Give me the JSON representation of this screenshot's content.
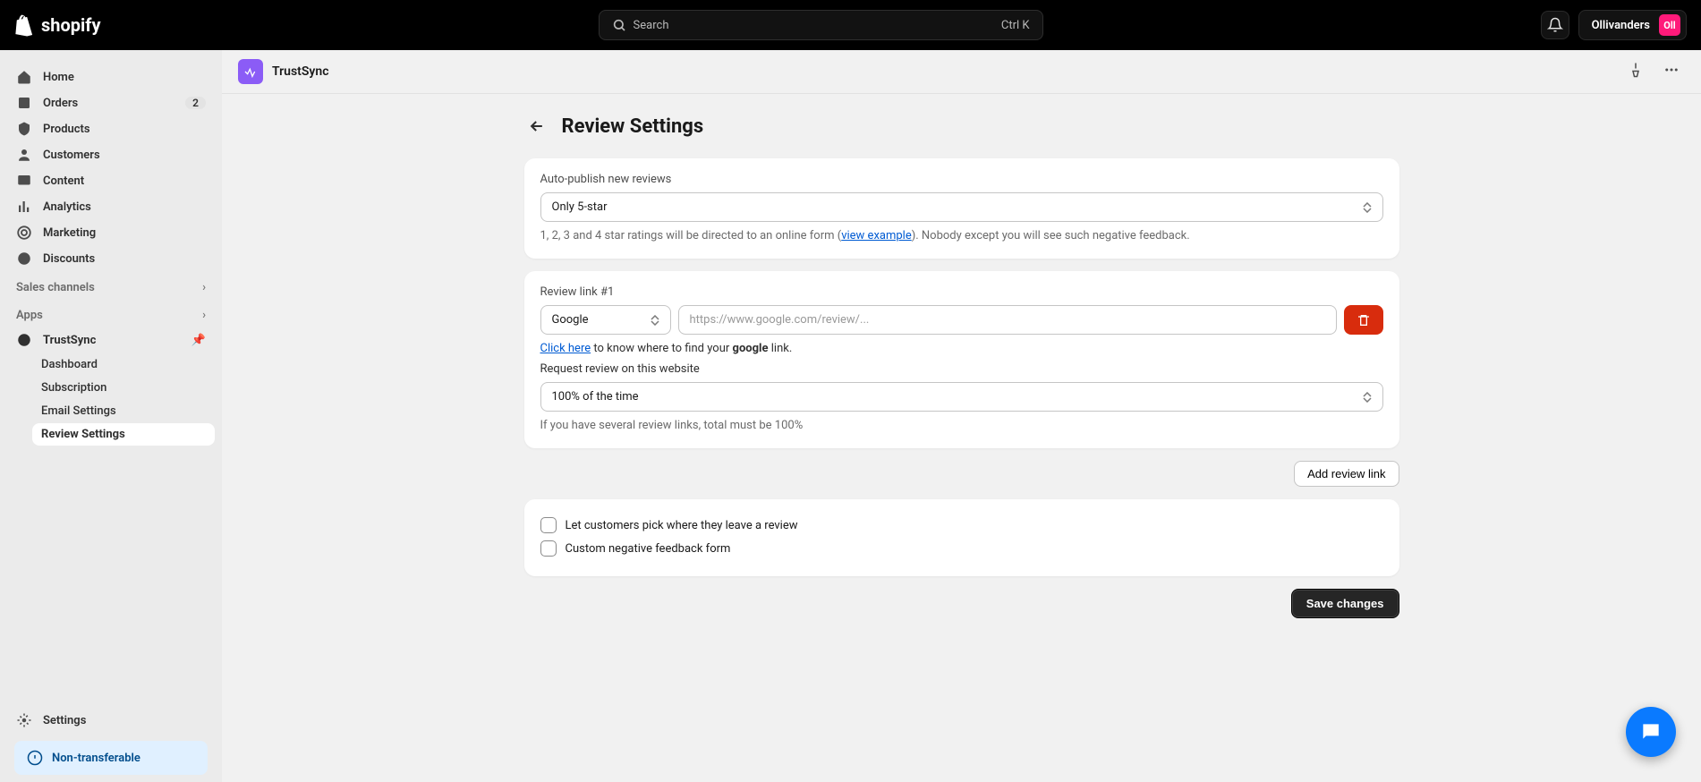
{
  "topbar": {
    "logo_text": "shopify",
    "search_placeholder": "Search",
    "search_shortcut": "Ctrl K",
    "store_name": "Ollivanders",
    "store_initials": "Oll"
  },
  "sidebar": {
    "items": [
      {
        "label": "Home",
        "icon": "home"
      },
      {
        "label": "Orders",
        "icon": "orders",
        "badge": "2"
      },
      {
        "label": "Products",
        "icon": "products"
      },
      {
        "label": "Customers",
        "icon": "customers"
      },
      {
        "label": "Content",
        "icon": "content"
      },
      {
        "label": "Analytics",
        "icon": "analytics"
      },
      {
        "label": "Marketing",
        "icon": "marketing"
      },
      {
        "label": "Discounts",
        "icon": "discounts"
      }
    ],
    "sales_channels_label": "Sales channels",
    "apps_label": "Apps",
    "app_name": "TrustSync",
    "app_subitems": [
      "Dashboard",
      "Subscription",
      "Email Settings",
      "Review Settings"
    ],
    "app_active_index": 3,
    "settings_label": "Settings",
    "pill_label": "Non-transferable"
  },
  "header": {
    "app_title": "TrustSync"
  },
  "page": {
    "title": "Review Settings",
    "card1": {
      "label": "Auto-publish new reviews",
      "select_value": "Only 5-star",
      "help_pre": "1, 2, 3 and 4 star ratings will be directed to an online form (",
      "help_link": "view example",
      "help_post": "). Nobody except you will see such negative feedback."
    },
    "card2": {
      "label": "Review link #1",
      "platform_value": "Google",
      "url_placeholder": "https://www.google.com/review/...",
      "hint_link": "Click here",
      "hint_mid": " to know where to find your ",
      "hint_bold": "google",
      "hint_post": " link.",
      "request_label": "Request review on this website",
      "freq_value": "100% of the time",
      "freq_help": "If you have several review links, total must be 100%"
    },
    "add_button": "Add review link",
    "card3": {
      "check1": "Let customers pick where they leave a review",
      "check2": "Custom negative feedback form"
    },
    "save_button": "Save changes"
  }
}
